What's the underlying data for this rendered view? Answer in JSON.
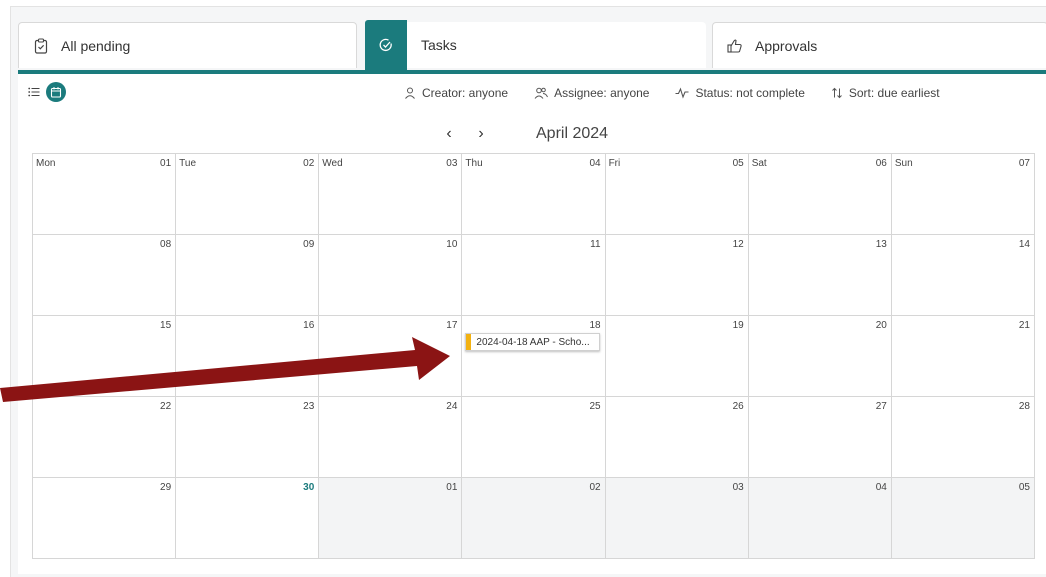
{
  "tabs": [
    {
      "label": "All pending",
      "icon": "clipboard-check-icon"
    },
    {
      "label": "Tasks",
      "icon": "check-circle-icon"
    },
    {
      "label": "Approvals",
      "icon": "thumbs-up-icon"
    }
  ],
  "filters": {
    "creator": "Creator: anyone",
    "assignee": "Assignee: anyone",
    "status": "Status: not complete",
    "sort": "Sort: due earliest"
  },
  "nav": {
    "prev": "‹",
    "next": "›",
    "month": "April 2024"
  },
  "days": [
    "Mon",
    "Tue",
    "Wed",
    "Thu",
    "Fri",
    "Sat",
    "Sun"
  ],
  "weeks": [
    [
      "01",
      "02",
      "03",
      "04",
      "05",
      "06",
      "07"
    ],
    [
      "08",
      "09",
      "10",
      "11",
      "12",
      "13",
      "14"
    ],
    [
      "15",
      "16",
      "17",
      "18",
      "19",
      "20",
      "21"
    ],
    [
      "22",
      "23",
      "24",
      "25",
      "26",
      "27",
      "28"
    ],
    [
      "29",
      "30",
      "01",
      "02",
      "03",
      "04",
      "05"
    ]
  ],
  "event": {
    "text": "2024-04-18 AAP - Scho...",
    "color": "#f2b111"
  },
  "colors": {
    "accent": "#1b7b7d",
    "arrow": "#8b1414"
  }
}
